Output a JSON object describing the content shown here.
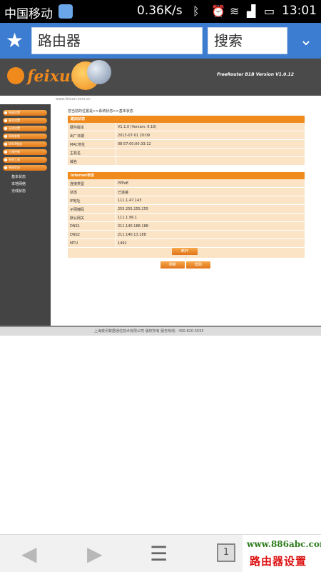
{
  "status_bar": {
    "carrier": "中国移动",
    "speed": "0.36K/s",
    "time": "13:01",
    "icons": [
      "qq-icon",
      "bluetooth-icon",
      "alarm-icon",
      "wifi-icon",
      "battery-icon"
    ]
  },
  "browser": {
    "url_text": "路由器",
    "search_label": "搜索"
  },
  "router": {
    "logo": "feixun",
    "logo_url": "www.feixun.com.cn",
    "version": "FreeRouter B1B Version V1.0.12",
    "breadcrumb": "您当前的位置是>>系统状态>>基本状态",
    "nav": [
      {
        "label": "快速设置"
      },
      {
        "label": "基本设置"
      },
      {
        "label": "无线设置"
      },
      {
        "label": "网络参数"
      },
      {
        "label": "DHCP服务"
      },
      {
        "label": "上网控制"
      },
      {
        "label": "系统工具"
      },
      {
        "label": "系统状态"
      }
    ],
    "sub_nav": [
      "基本状态",
      "本地网络",
      "无线状态"
    ],
    "router_info": {
      "title": "路由状态",
      "rows": [
        {
          "key": "硬件版本",
          "value": "V1.1.0 (Version: 6.10)"
        },
        {
          "key": "出厂日期",
          "value": "2013-07-01 20:09"
        },
        {
          "key": "MAC地址",
          "value": "08:57:00:00:33:12"
        },
        {
          "key": "主机名",
          "value": ""
        },
        {
          "key": "域名",
          "value": ""
        }
      ]
    },
    "internet_info": {
      "title": "Internet状态",
      "rows": [
        {
          "key": "连接类型",
          "value": "PPPoE"
        },
        {
          "key": "状态",
          "value": "已连接"
        },
        {
          "key": "IP地址",
          "value": "111.1.47.143"
        },
        {
          "key": "子网掩码",
          "value": "255.255.255.255"
        },
        {
          "key": "默认网关",
          "value": "111.1.96.1"
        },
        {
          "key": "DNS1",
          "value": "211.140.188.188"
        },
        {
          "key": "DNS2",
          "value": "211.140.13.188"
        },
        {
          "key": "MTU",
          "value": "1492"
        }
      ],
      "button": "断开"
    },
    "refresh_button": "刷新",
    "help_button": "帮助",
    "footer": "上海斐讯数据通信技术有限公司  版权所有  服务热线：400-820-5555"
  },
  "watermark": {
    "site": "www.886abc.com",
    "text": "路由器设置"
  },
  "bottom_nav": {
    "tab_count": "1"
  }
}
